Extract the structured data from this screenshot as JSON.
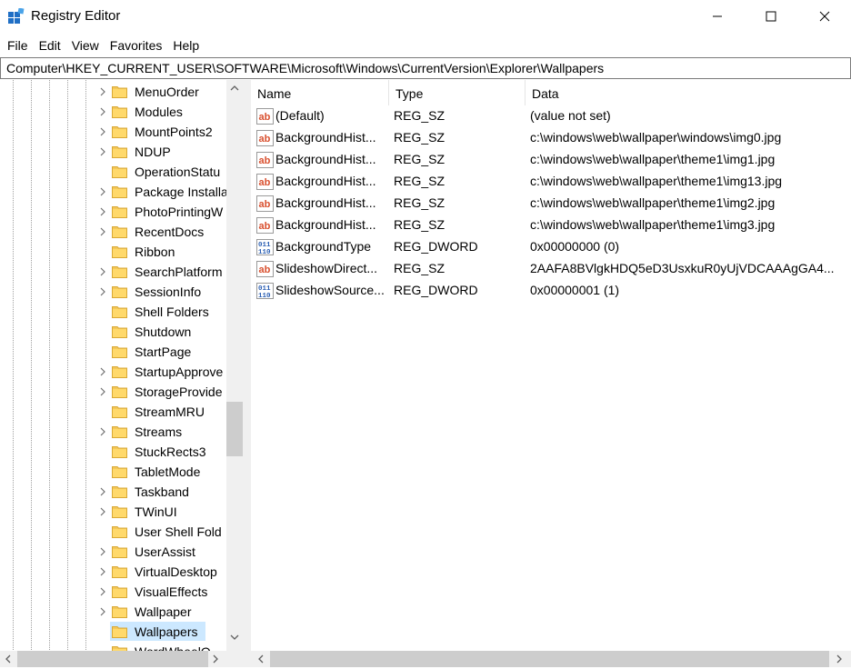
{
  "window": {
    "title": "Registry Editor",
    "minimize_icon": "minimize-icon",
    "maximize_icon": "maximize-icon",
    "close_icon": "close-icon"
  },
  "menu": [
    "File",
    "Edit",
    "View",
    "Favorites",
    "Help"
  ],
  "address": "Computer\\HKEY_CURRENT_USER\\SOFTWARE\\Microsoft\\Windows\\CurrentVersion\\Explorer\\Wallpapers",
  "tree": {
    "items": [
      {
        "label": "MenuOrder",
        "expandable": true
      },
      {
        "label": "Modules",
        "expandable": true
      },
      {
        "label": "MountPoints2",
        "expandable": true
      },
      {
        "label": "NDUP",
        "expandable": true
      },
      {
        "label": "OperationStatu",
        "expandable": false
      },
      {
        "label": "Package Installa",
        "expandable": true
      },
      {
        "label": "PhotoPrintingW",
        "expandable": true
      },
      {
        "label": "RecentDocs",
        "expandable": true
      },
      {
        "label": "Ribbon",
        "expandable": false
      },
      {
        "label": "SearchPlatform",
        "expandable": true
      },
      {
        "label": "SessionInfo",
        "expandable": true
      },
      {
        "label": "Shell Folders",
        "expandable": false
      },
      {
        "label": "Shutdown",
        "expandable": false
      },
      {
        "label": "StartPage",
        "expandable": false
      },
      {
        "label": "StartupApprove",
        "expandable": true
      },
      {
        "label": "StorageProvide",
        "expandable": true
      },
      {
        "label": "StreamMRU",
        "expandable": false
      },
      {
        "label": "Streams",
        "expandable": true
      },
      {
        "label": "StuckRects3",
        "expandable": false
      },
      {
        "label": "TabletMode",
        "expandable": false
      },
      {
        "label": "Taskband",
        "expandable": true
      },
      {
        "label": "TWinUI",
        "expandable": true
      },
      {
        "label": "User Shell Fold",
        "expandable": false
      },
      {
        "label": "UserAssist",
        "expandable": true
      },
      {
        "label": "VirtualDesktop",
        "expandable": true
      },
      {
        "label": "VisualEffects",
        "expandable": true
      },
      {
        "label": "Wallpaper",
        "expandable": true
      },
      {
        "label": "Wallpapers",
        "expandable": false,
        "selected": true
      },
      {
        "label": "WordWheelQ",
        "expandable": false
      }
    ]
  },
  "list": {
    "columns": {
      "name": "Name",
      "type": "Type",
      "data": "Data"
    },
    "rows": [
      {
        "icon": "string-value-icon",
        "name": "(Default)",
        "type": "REG_SZ",
        "data": "(value not set)"
      },
      {
        "icon": "string-value-icon",
        "name": "BackgroundHist...",
        "type": "REG_SZ",
        "data": "c:\\windows\\web\\wallpaper\\windows\\img0.jpg"
      },
      {
        "icon": "string-value-icon",
        "name": "BackgroundHist...",
        "type": "REG_SZ",
        "data": "c:\\windows\\web\\wallpaper\\theme1\\img1.jpg"
      },
      {
        "icon": "string-value-icon",
        "name": "BackgroundHist...",
        "type": "REG_SZ",
        "data": "c:\\windows\\web\\wallpaper\\theme1\\img13.jpg"
      },
      {
        "icon": "string-value-icon",
        "name": "BackgroundHist...",
        "type": "REG_SZ",
        "data": "c:\\windows\\web\\wallpaper\\theme1\\img2.jpg"
      },
      {
        "icon": "string-value-icon",
        "name": "BackgroundHist...",
        "type": "REG_SZ",
        "data": "c:\\windows\\web\\wallpaper\\theme1\\img3.jpg"
      },
      {
        "icon": "binary-value-icon",
        "name": "BackgroundType",
        "type": "REG_DWORD",
        "data": "0x00000000 (0)"
      },
      {
        "icon": "string-value-icon",
        "name": "SlideshowDirect...",
        "type": "REG_SZ",
        "data": "2AAFA8BVlgkHDQ5eD3UsxkuR0yUjVDCAAAgGA4..."
      },
      {
        "icon": "binary-value-icon",
        "name": "SlideshowSource...",
        "type": "REG_DWORD",
        "data": "0x00000001 (1)"
      }
    ]
  },
  "colors": {
    "selection": "#cce8ff",
    "scrollbar_track": "#f0f0f0",
    "scrollbar_thumb": "#cdcdcd",
    "string_icon": "#d9502f",
    "dword_icon": "#2b5fb3",
    "folder": "#f4c85a"
  }
}
